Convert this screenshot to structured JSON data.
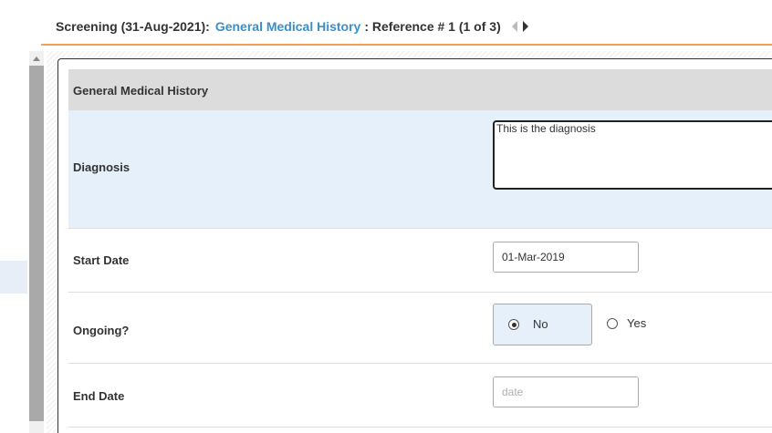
{
  "header": {
    "prefix": "Screening (31-Aug-2021):",
    "form_link": "General Medical History",
    "reference": ": Reference # 1  (1 of 3)",
    "prev_icon": "triangle-left",
    "next_icon": "triangle-right"
  },
  "section": {
    "title": "General Medical History"
  },
  "fields": {
    "diagnosis": {
      "label": "Diagnosis",
      "value": "This is the diagnosis"
    },
    "start_date": {
      "label": "Start Date",
      "value": "01-Mar-2019"
    },
    "ongoing": {
      "label": "Ongoing?",
      "options": [
        "No",
        "Yes"
      ],
      "selected": "No"
    },
    "end_date": {
      "label": "End Date",
      "placeholder": "date"
    }
  },
  "colors": {
    "accent_orange": "#f0a050",
    "link_blue": "#3a8fc8",
    "highlight_row": "#e6f0fa",
    "section_header": "#dcdcdc"
  }
}
